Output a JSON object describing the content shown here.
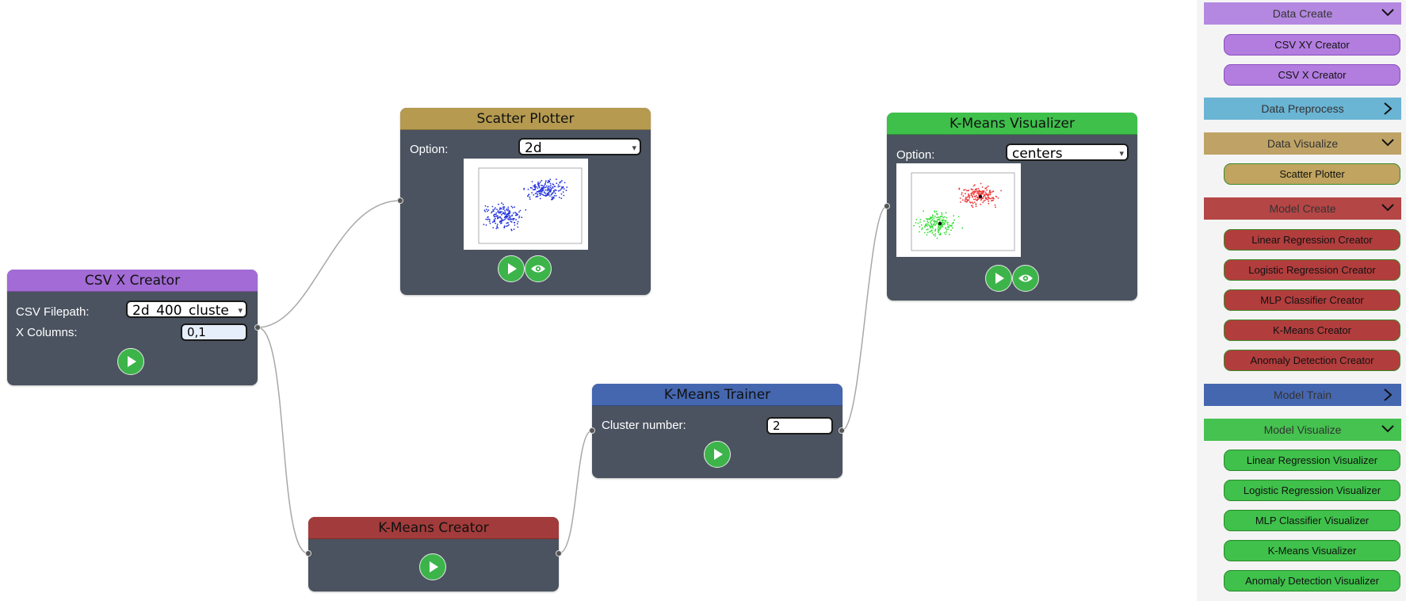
{
  "nodes": {
    "csv_x_creator": {
      "title": "CSV X Creator",
      "filepath_label": "CSV Filepath:",
      "filepath_value": "2d_400_cluste",
      "columns_label": "X Columns:",
      "columns_value": "0,1",
      "color": "#a26bd5"
    },
    "scatter_plotter": {
      "title": "Scatter Plotter",
      "option_label": "Option:",
      "option_value": "2d",
      "color": "#b59a50"
    },
    "kmeans_creator": {
      "title": "K-Means Creator",
      "color": "#a23b3b"
    },
    "kmeans_trainer": {
      "title": "K-Means Trainer",
      "cluster_label": "Cluster number:",
      "cluster_value": "2",
      "color": "#4567b0"
    },
    "kmeans_visualizer": {
      "title": "K-Means Visualizer",
      "option_label": "Option:",
      "option_value": "centers",
      "color": "#3ec04b"
    }
  },
  "sidebar": {
    "categories": [
      {
        "label": "Data Create",
        "color": "#b488e0",
        "expanded": true,
        "items": [
          "CSV XY Creator",
          "CSV X Creator"
        ],
        "item_color": "#b27ddf",
        "item_border": "#8a4bbf"
      },
      {
        "label": "Data Preprocess",
        "color": "#6ab4d4",
        "expanded": false,
        "items": []
      },
      {
        "label": "Data Visualize",
        "color": "#bfa366",
        "expanded": true,
        "items": [
          "Scatter Plotter"
        ],
        "item_color": "#c0a45f",
        "item_border": "#3a8a2a"
      },
      {
        "label": "Model Create",
        "color": "#b54646",
        "expanded": true,
        "items": [
          "Linear Regression Creator",
          "Logistic Regression Creator",
          "MLP Classifier Creator",
          "K-Means Creator",
          "Anomaly Detection Creator"
        ],
        "item_color": "#b23d3d",
        "item_border": "#3a8a2a"
      },
      {
        "label": "Model Train",
        "color": "#4567b0",
        "expanded": false,
        "items": []
      },
      {
        "label": "Model Visualize",
        "color": "#45c24f",
        "expanded": true,
        "items": [
          "Linear Regression Visualizer",
          "Logistic Regression Visualizer",
          "MLP Classifier Visualizer",
          "K-Means Visualizer",
          "Anomaly Detection Visualizer"
        ],
        "item_color": "#3fc14b",
        "item_border": "#2a8a2a"
      }
    ]
  }
}
